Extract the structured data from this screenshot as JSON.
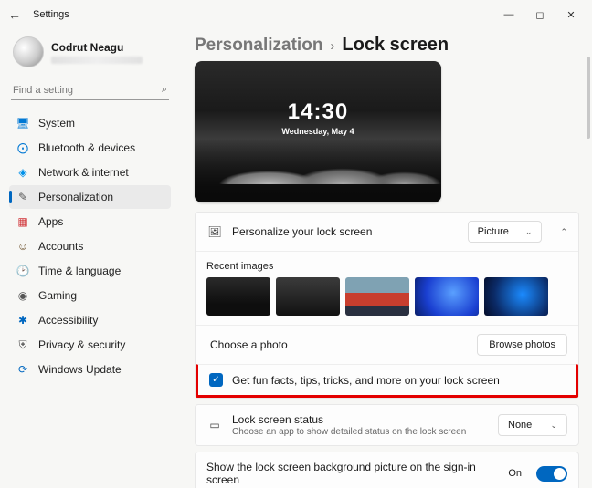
{
  "window": {
    "title": "Settings"
  },
  "user": {
    "name": "Codrut Neagu"
  },
  "search": {
    "placeholder": "Find a setting"
  },
  "nav": [
    {
      "key": "system",
      "label": "System",
      "color": "#0078d4",
      "glyph": "🖥"
    },
    {
      "key": "bluetooth",
      "label": "Bluetooth & devices",
      "color": "#0078d4",
      "glyph": "⨀"
    },
    {
      "key": "network",
      "label": "Network & internet",
      "color": "#0091ea",
      "glyph": "◈"
    },
    {
      "key": "personalization",
      "label": "Personalization",
      "color": "#555",
      "glyph": "✎"
    },
    {
      "key": "apps",
      "label": "Apps",
      "color": "#d13438",
      "glyph": "▦"
    },
    {
      "key": "accounts",
      "label": "Accounts",
      "color": "#6b4f2a",
      "glyph": "☺"
    },
    {
      "key": "time",
      "label": "Time & language",
      "color": "#555",
      "glyph": "🕑"
    },
    {
      "key": "gaming",
      "label": "Gaming",
      "color": "#555",
      "glyph": "◉"
    },
    {
      "key": "accessibility",
      "label": "Accessibility",
      "color": "#0067c0",
      "glyph": "✱"
    },
    {
      "key": "privacy",
      "label": "Privacy & security",
      "color": "#555",
      "glyph": "⛨"
    },
    {
      "key": "update",
      "label": "Windows Update",
      "color": "#0067c0",
      "glyph": "⟳"
    }
  ],
  "nav_active": "personalization",
  "breadcrumb": {
    "parent": "Personalization",
    "sep": "›",
    "current": "Lock screen"
  },
  "preview": {
    "time": "14:30",
    "date": "Wednesday, May 4"
  },
  "panel": {
    "personalize_label": "Personalize your lock screen",
    "dropdown_value": "Picture",
    "recent_label": "Recent images",
    "choose_label": "Choose a photo",
    "browse_label": "Browse photos",
    "funfacts_label": "Get fun facts, tips, tricks, and more on your lock screen",
    "funfacts_checked": true
  },
  "status_card": {
    "title": "Lock screen status",
    "subtitle": "Choose an app to show detailed status on the lock screen",
    "dropdown_value": "None"
  },
  "signin_card": {
    "label": "Show the lock screen background picture on the sign-in screen",
    "state_label": "On",
    "state": true
  }
}
